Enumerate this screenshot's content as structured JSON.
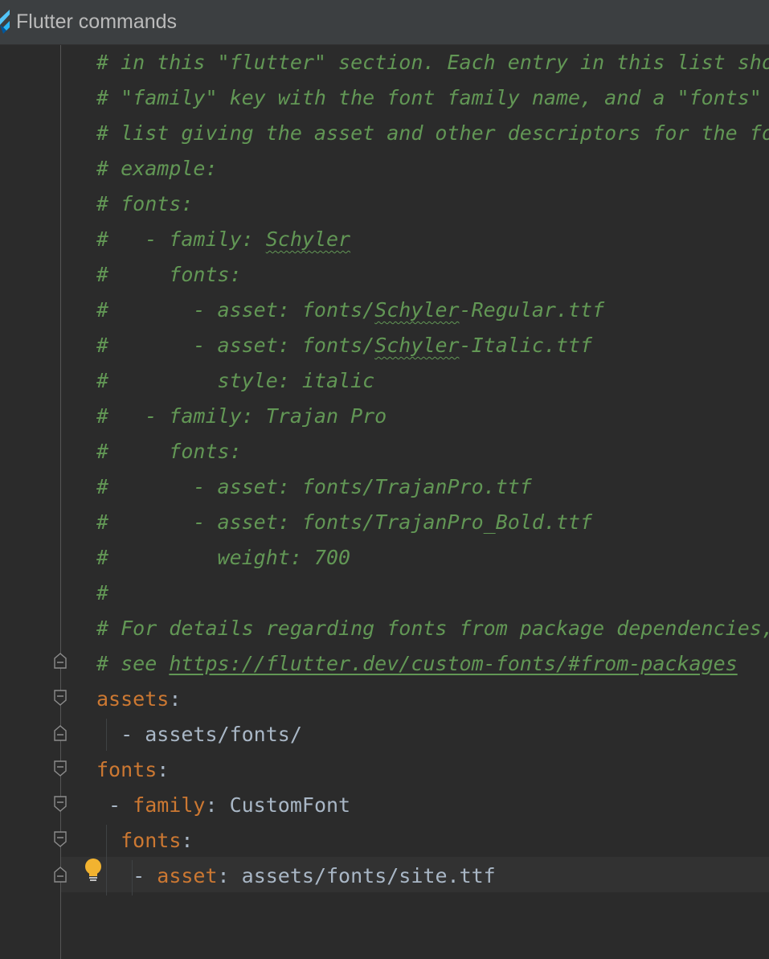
{
  "topbar": {
    "title": "Flutter commands",
    "icon": "flutter-icon"
  },
  "lines": [
    "# in this \"flutter\" section. Each entry in this list should have a",
    "# \"family\" key with the font family name, and a \"fonts\" key with a",
    "# list giving the asset and other descriptors for the font. For",
    "# example:",
    "# fonts:",
    "#   - family: ",
    "#     fonts:",
    "#       - asset: fonts/",
    "#       - asset: fonts/",
    "#         style: italic",
    "#   - family: Trajan Pro",
    "#     fonts:",
    "#       - asset: fonts/TrajanPro.ttf",
    "#       - asset: fonts/TrajanPro_Bold.ttf",
    "#         weight: 700",
    "#",
    "# For details regarding fonts from package dependencies,",
    "# see "
  ],
  "spell": {
    "schyler": "Schyler",
    "regular_suffix": "-Regular.ttf",
    "italic_suffix": "-Italic.ttf"
  },
  "link_text": "https://flutter.dev/custom-fonts/#from-packages",
  "yaml": {
    "assets_key": "assets",
    "colon": ":",
    "assets_dash": "  - ",
    "assets_value": "assets/fonts/",
    "fonts_key": "fonts",
    "family_dash": " - ",
    "family_key": "family",
    "family_value": " CustomFont",
    "fonts2_indent": "  ",
    "fonts2_key": "fonts",
    "asset_dash": "   - ",
    "asset_key": "asset",
    "asset_value": " assets/fonts/site.ttf"
  },
  "colors": {
    "comment": "#629755",
    "key": "#cc7832",
    "text": "#a9b7c6",
    "background": "#2b2b2b"
  },
  "icons": [
    "flutter-icon",
    "fold-icon",
    "intention-bulb-icon"
  ]
}
